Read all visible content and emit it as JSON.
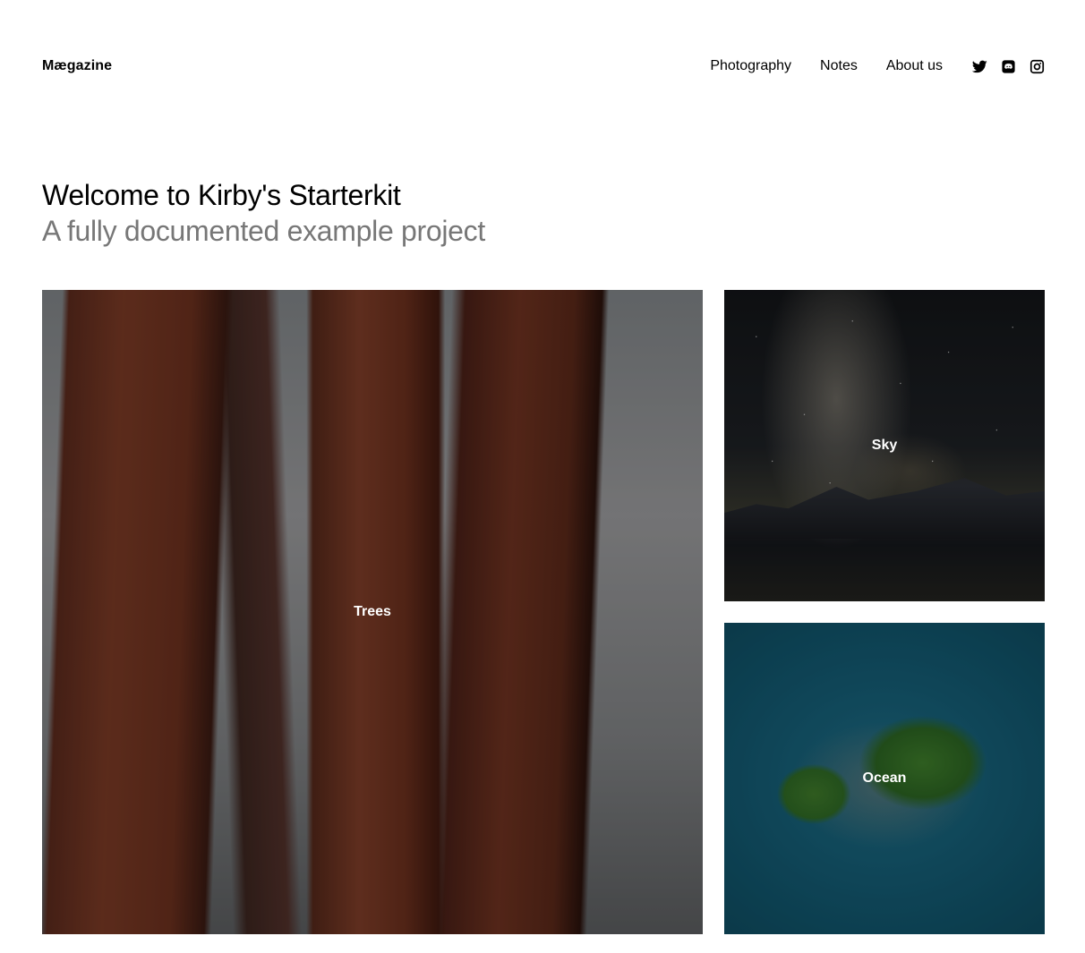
{
  "header": {
    "logo": "Mægazine",
    "nav": [
      {
        "label": "Photography"
      },
      {
        "label": "Notes"
      },
      {
        "label": "About us"
      }
    ],
    "social": [
      "twitter-icon",
      "discord-icon",
      "instagram-icon"
    ]
  },
  "intro": {
    "title": "Welcome to Kirby's Starterkit",
    "subtitle": "A fully documented example project"
  },
  "gallery": [
    {
      "label": "Trees"
    },
    {
      "label": "Sky"
    },
    {
      "label": "Ocean"
    }
  ],
  "colors": {
    "text": "#000000",
    "subtitle": "#777777",
    "tile_label": "#ffffff"
  }
}
